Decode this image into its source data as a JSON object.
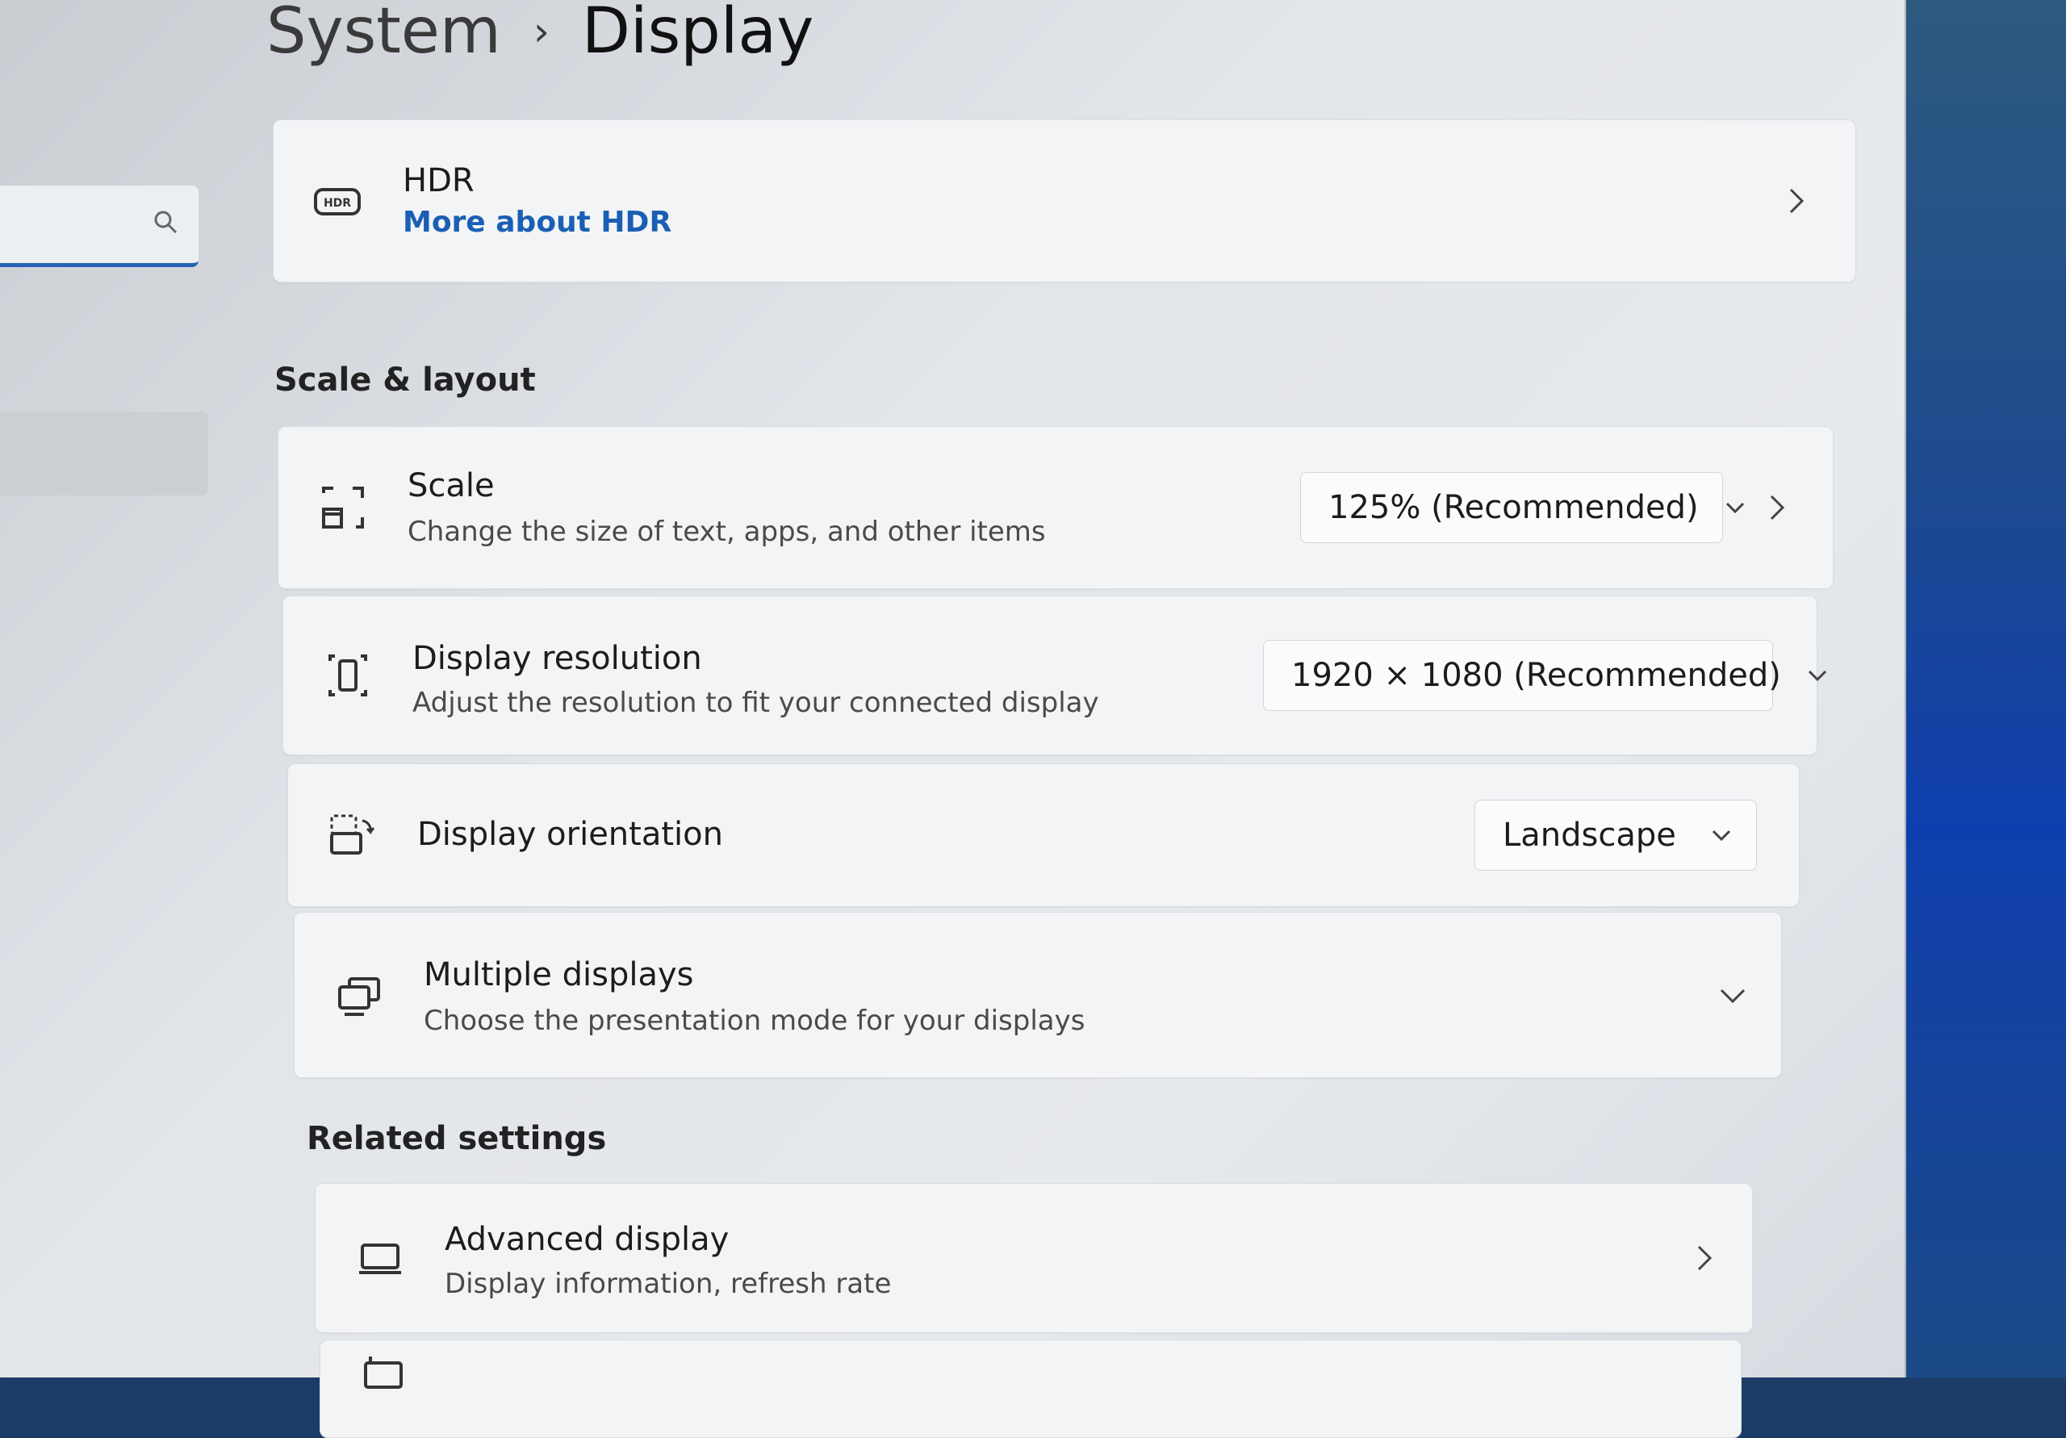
{
  "header": {
    "parent": "System",
    "separator": "›",
    "current": "Display"
  },
  "sidebar": {
    "search_placeholder": ""
  },
  "hdr_card": {
    "title": "HDR",
    "link": "More about HDR",
    "icon": "hdr-icon"
  },
  "scale_layout": {
    "heading": "Scale & layout",
    "scale": {
      "title": "Scale",
      "subtitle": "Change the size of text, apps, and other items",
      "value": "125% (Recommended)",
      "icon": "scale-icon"
    },
    "resolution": {
      "title": "Display resolution",
      "subtitle": "Adjust the resolution to fit your connected display",
      "value": "1920 × 1080 (Recommended)",
      "icon": "resolution-icon"
    },
    "orientation": {
      "title": "Display orientation",
      "value": "Landscape",
      "icon": "orientation-icon"
    },
    "multiple": {
      "title": "Multiple displays",
      "subtitle": "Choose the presentation mode for your displays",
      "icon": "multiple-displays-icon"
    }
  },
  "related": {
    "heading": "Related settings",
    "advanced": {
      "title": "Advanced display",
      "subtitle": "Display information, refresh rate",
      "icon": "monitor-icon"
    }
  },
  "colors": {
    "accent": "#1a5fb4",
    "window_bg": "#e2e5ea",
    "card_bg": "#f3f4f6"
  }
}
